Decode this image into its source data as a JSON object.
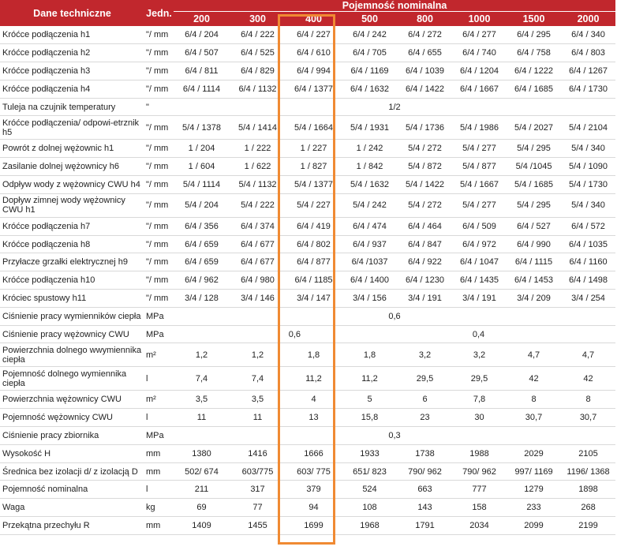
{
  "header": {
    "label_col": "Dane techniczne",
    "unit_col": "Jedn.",
    "group": "Pojemność nominalna",
    "capacities": [
      "200",
      "300",
      "400",
      "500",
      "800",
      "1000",
      "1500",
      "2000"
    ]
  },
  "rows": [
    {
      "label": "Króćce podłączenia h1",
      "unit": "\"/ mm",
      "values": [
        "6/4  /  204",
        "6/4  /  222",
        "6/4  /  227",
        "6/4  /  242",
        "6/4  /  272",
        "6/4  /  277",
        "6/4  /  295",
        "6/4  /  340"
      ]
    },
    {
      "label": "Króćce podłączenia h2",
      "unit": "\"/ mm",
      "values": [
        "6/4  /  507",
        "6/4  /  525",
        "6/4  /  610",
        "6/4  /  705",
        "6/4  /  655",
        "6/4  /  740",
        "6/4  /  758",
        "6/4  /  803"
      ]
    },
    {
      "label": "Króćce podłączenia h3",
      "unit": "\"/ mm",
      "values": [
        "6/4  /  811",
        "6/4  /  829",
        "6/4  /  994",
        "6/4  /  1169",
        "6/4  /  1039",
        "6/4  /  1204",
        "6/4  /  1222",
        "6/4  /  1267"
      ]
    },
    {
      "label": "Króćce podłączenia h4",
      "unit": "\"/ mm",
      "values": [
        "6/4  /  1114",
        "6/4  /  1132",
        "6/4  /  1377",
        "6/4  /  1632",
        "6/4  /  1422",
        "6/4  /  1667",
        "6/4  /  1685",
        "6/4  /  1730"
      ]
    },
    {
      "label": "Tuleja na czujnik temperatury",
      "unit": "\"",
      "span": "1/2"
    },
    {
      "label": "Króćce podłączenia/ odpowi-etrznik h5",
      "unit": "\"/ mm",
      "tall": true,
      "values": [
        "5/4  / 1378",
        "5/4  /  1414",
        "5/4  /  1664",
        "5/4  /  1931",
        "5/4  /  1736",
        "5/4  /  1986",
        "5/4  /  2027",
        "5/4  /  2104"
      ]
    },
    {
      "label": "Powrót z dolnej wężownic h1",
      "unit": "\"/ mm",
      "values": [
        "1  /  204",
        "1  /  222",
        "1  /  227",
        "1  /  242",
        "5/4  /  272",
        "5/4  /  277",
        "5/4  /  295",
        "5/4  /  340"
      ]
    },
    {
      "label": "Zasilanie dolnej wężownicy h6",
      "unit": "\"/ mm",
      "values": [
        "1  /  604",
        "1  /  622",
        "1  /  827",
        "1  /  842",
        "5/4  /  872",
        "5/4  /  877",
        "5/4  /1045",
        "5/4  /  1090"
      ]
    },
    {
      "label": "Odpływ wody z wężownicy CWU h4",
      "unit": "\"/ mm",
      "values": [
        "5/4  /  1114",
        "5/4  /  1132",
        "5/4  /  1377",
        "5/4  /  1632",
        "5/4  /  1422",
        "5/4  /  1667",
        "5/4  /  1685",
        "5/4  /  1730"
      ]
    },
    {
      "label": "Dopływ zimnej wody wężownicy CWU h1",
      "unit": "\"/ mm",
      "tall": true,
      "values": [
        "5/4  /  204",
        "5/4  /  222",
        "5/4  /  227",
        "5/4  /  242",
        "5/4  /  272",
        "5/4  /  277",
        "5/4  /  295",
        "5/4  /  340"
      ]
    },
    {
      "label": "Króćce podłączenia h7",
      "unit": "\"/ mm",
      "values": [
        "6/4  /  356",
        "6/4  /  374",
        "6/4  /  419",
        "6/4  /  474",
        "6/4  /  464",
        "6/4  /  509",
        "6/4  /  527",
        "6/4  /  572"
      ]
    },
    {
      "label": "Króćce podłączenia h8",
      "unit": "\"/ mm",
      "values": [
        "6/4  /  659",
        "6/4  /  677",
        "6/4  /  802",
        "6/4  /  937",
        "6/4  /  847",
        "6/4  /  972",
        "6/4  /  990",
        "6/4  /  1035"
      ]
    },
    {
      "label": "Przyłacze grzałki elektrycznej h9",
      "unit": "\"/ mm",
      "values": [
        "6/4  /  659",
        "6/4  /  677",
        "6/4  /  877",
        "6/4  /1037",
        "6/4  /  922",
        "6/4  /  1047",
        "6/4  /  1115",
        "6/4  /  1160"
      ]
    },
    {
      "label": "Króćce podłączenia h10",
      "unit": "\"/ mm",
      "values": [
        "6/4  /  962",
        "6/4  /  980",
        "6/4  /  1185",
        "6/4  /  1400",
        "6/4  /  1230",
        "6/4  /  1435",
        "6/4  /  1453",
        "6/4  /  1498"
      ]
    },
    {
      "label": "Króciec spustowy h11",
      "unit": "\"/ mm",
      "values": [
        "3/4  /  128",
        "3/4  /  146",
        "3/4  /  147",
        "3/4  /  156",
        "3/4  /  191",
        "3/4  /  191",
        "3/4  /  209",
        "3/4  /  254"
      ]
    },
    {
      "label": "Ciśnienie pracy wymienników ciepła",
      "unit": "MPa",
      "span": "0,6"
    },
    {
      "label": "Ciśnienie pracy wężownicy CWU",
      "unit": "MPa",
      "split": [
        "0,6",
        "0,4"
      ]
    },
    {
      "label": "Powierzchnia dolnego wwymiennika ciepła",
      "unit": "m²",
      "tall": true,
      "values": [
        "1,2",
        "1,2",
        "1,8",
        "1,8",
        "3,2",
        "3,2",
        "4,7",
        "4,7"
      ]
    },
    {
      "label": "Pojemność dolnego wymiennika ciepła",
      "unit": "l",
      "tall": true,
      "values": [
        "7,4",
        "7,4",
        "11,2",
        "11,2",
        "29,5",
        "29,5",
        "42",
        "42"
      ]
    },
    {
      "label": "Powierzchnia wężownicy CWU",
      "unit": "m²",
      "values": [
        "3,5",
        "3,5",
        "4",
        "5",
        "6",
        "7,8",
        "8",
        "8"
      ]
    },
    {
      "label": "Pojemność wężownicy CWU",
      "unit": "l",
      "values": [
        "11",
        "11",
        "13",
        "15,8",
        "23",
        "30",
        "30,7",
        "30,7"
      ]
    },
    {
      "label": "Ciśnienie pracy zbiornika",
      "unit": "MPa",
      "span": "0,3"
    },
    {
      "label": "Wysokość H",
      "unit": "mm",
      "values": [
        "1380",
        "1416",
        "1666",
        "1933",
        "1738",
        "1988",
        "2029",
        "2105"
      ]
    },
    {
      "label": "Średnica bez izolacji d/ z izolacją D",
      "unit": "mm",
      "values": [
        "502/ 674",
        "603/775",
        "603/ 775",
        "651/ 823",
        "790/ 962",
        "790/ 962",
        "997/ 1169",
        "1196/ 1368"
      ]
    },
    {
      "label": "Pojemność nominalna",
      "unit": "l",
      "values": [
        "211",
        "317",
        "379",
        "524",
        "663",
        "777",
        "1279",
        "1898"
      ]
    },
    {
      "label": "Waga",
      "unit": "kg",
      "values": [
        "69",
        "77",
        "94",
        "108",
        "143",
        "158",
        "233",
        "268"
      ]
    },
    {
      "label": "Przekątna przechyłu R",
      "unit": "mm",
      "values": [
        "1409",
        "1455",
        "1699",
        "1968",
        "1791",
        "2034",
        "2099",
        "2199"
      ]
    }
  ],
  "colors": {
    "header_bg": "#c1272d",
    "highlight_border": "#f08a33"
  }
}
